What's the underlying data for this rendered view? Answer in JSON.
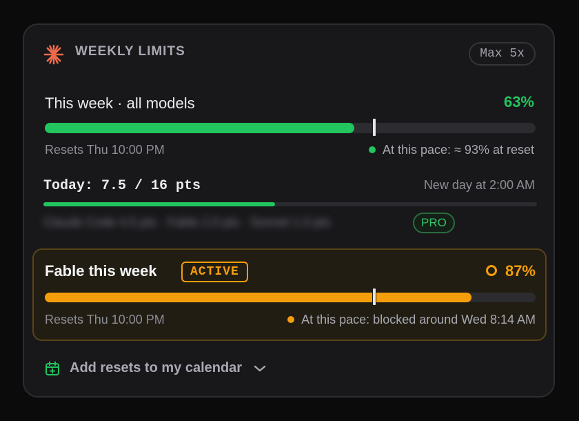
{
  "header": {
    "title": "WEEKLY LIMITS",
    "plan": "Max 5x",
    "icon": "sparkle-burst-icon",
    "accent": "#f0694a"
  },
  "all_models": {
    "label": "This week · all models",
    "percent_label": "63%",
    "progress": 0.63,
    "pace_marker": 0.671,
    "reset_text": "Resets Thu 10:00 PM",
    "pace_text": "At this pace: ≈ 93% at reset",
    "color": "#22c55e"
  },
  "today": {
    "label": "Today: 7.5 / 16 pts",
    "progress": 0.4688,
    "new_day_text": "New day at 2:00 AM",
    "blurred_text": "Claude Code 4.5 pts · Fable 2.0 pts · Sonnet 1.0 pts",
    "pro_badge": "PRO",
    "color": "#22c55e"
  },
  "fable": {
    "label": "Fable this week",
    "status_badge": "ACTIVE",
    "percent_label": "87%",
    "progress": 0.87,
    "pace_marker": 0.671,
    "reset_text": "Resets Thu 10:00 PM",
    "pace_text": "At this pace: blocked around Wed 8:14 AM",
    "color": "#f59e0b"
  },
  "calendar": {
    "label": "Add resets to my calendar",
    "icon": "calendar-plus-icon",
    "chevron": "chevron-down-icon"
  }
}
